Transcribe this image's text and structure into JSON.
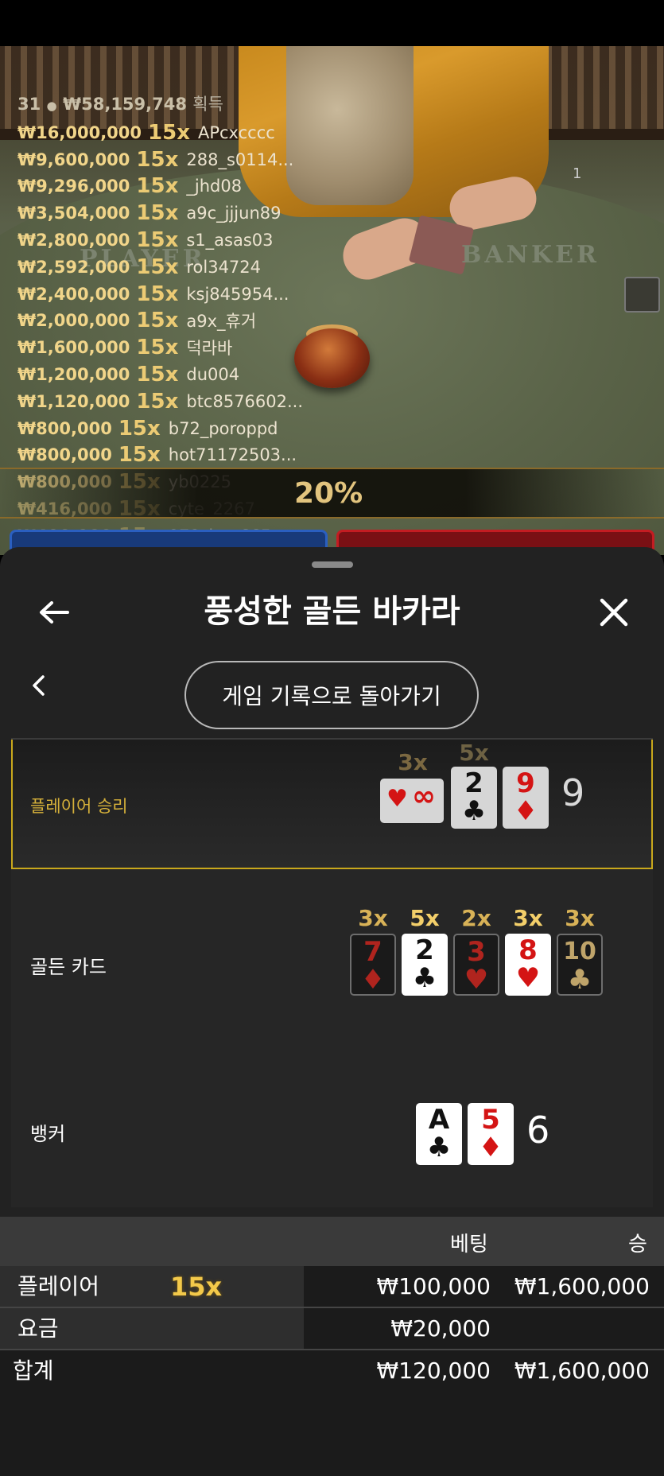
{
  "live": {
    "player_count": "31",
    "total_amount": "₩58,159,748",
    "total_label": "획득",
    "dealer_number": "1",
    "table_text_player": "PLAYER",
    "table_text_banker": "BANKER",
    "percent": "20%",
    "leaderboard": [
      {
        "amount": "₩16,000,000",
        "mult": "15x",
        "user": "APcxcccc"
      },
      {
        "amount": "₩9,600,000",
        "mult": "15x",
        "user": "288_s0114..."
      },
      {
        "amount": "₩9,296,000",
        "mult": "15x",
        "user": "_jhd08"
      },
      {
        "amount": "₩3,504,000",
        "mult": "15x",
        "user": "a9c_jjjun89"
      },
      {
        "amount": "₩2,800,000",
        "mult": "15x",
        "user": "s1_asas03"
      },
      {
        "amount": "₩2,592,000",
        "mult": "15x",
        "user": "rol34724"
      },
      {
        "amount": "₩2,400,000",
        "mult": "15x",
        "user": "ksj845954..."
      },
      {
        "amount": "₩2,000,000",
        "mult": "15x",
        "user": "a9x_휴거"
      },
      {
        "amount": "₩1,600,000",
        "mult": "15x",
        "user": "덕라바"
      },
      {
        "amount": "₩1,200,000",
        "mult": "15x",
        "user": "du004"
      },
      {
        "amount": "₩1,120,000",
        "mult": "15x",
        "user": "btc8576602..."
      },
      {
        "amount": "₩800,000",
        "mult": "15x",
        "user": "b72_poroppd"
      },
      {
        "amount": "₩800,000",
        "mult": "15x",
        "user": "hot71172503..."
      },
      {
        "amount": "₩800,000",
        "mult": "15x",
        "user": "yb0225"
      },
      {
        "amount": "₩416,000",
        "mult": "15x",
        "user": "cyte_2267"
      },
      {
        "amount": "₩400,000",
        "mult": "15x",
        "user": "079_jym665"
      }
    ],
    "colors": {
      "player_tab": "#1e4fa8",
      "banker_tab": "#b0161c",
      "gold": "#e2c47e"
    }
  },
  "sheet": {
    "title": "풍성한 골든 바카라",
    "back_button_icon": "arrow-left-icon",
    "close_button_icon": "close-icon",
    "history_button": "게임 기록으로 돌아가기",
    "prev_icon": "chevron-left-icon"
  },
  "result": {
    "player": {
      "label": "플레이어 승리",
      "score": "9",
      "cards": [
        {
          "rank": "∞",
          "suit": "♥",
          "color": "red",
          "mult": "3x"
        },
        {
          "rank": "2",
          "suit": "♣",
          "color": "black",
          "mult": "5x"
        },
        {
          "rank": "9",
          "suit": "♦",
          "color": "red",
          "mult": ""
        }
      ]
    },
    "golden": {
      "label": "골든 카드",
      "cards": [
        {
          "rank": "7",
          "suit": "♦",
          "color": "red",
          "mult": "3x",
          "highlight": false
        },
        {
          "rank": "2",
          "suit": "♣",
          "color": "black",
          "mult": "5x",
          "highlight": true
        },
        {
          "rank": "3",
          "suit": "♥",
          "color": "red",
          "mult": "2x",
          "highlight": false
        },
        {
          "rank": "8",
          "suit": "♥",
          "color": "red",
          "mult": "3x",
          "highlight": true
        },
        {
          "rank": "10",
          "suit": "♣",
          "color": "black",
          "mult": "3x",
          "highlight": false
        }
      ]
    },
    "banker": {
      "label": "뱅커",
      "score": "6",
      "cards": [
        {
          "rank": "A",
          "suit": "♣",
          "color": "black"
        },
        {
          "rank": "5",
          "suit": "♦",
          "color": "red"
        }
      ]
    }
  },
  "bets": {
    "header_bet": "베팅",
    "header_win": "승",
    "rows": [
      {
        "name": "플레이어",
        "mult": "15x",
        "bet": "₩100,000",
        "win": "₩1,600,000"
      },
      {
        "name": "요금",
        "mult": "",
        "bet": "₩20,000",
        "win": ""
      }
    ],
    "total": {
      "name": "합계",
      "bet": "₩120,000",
      "win": "₩1,600,000"
    }
  }
}
